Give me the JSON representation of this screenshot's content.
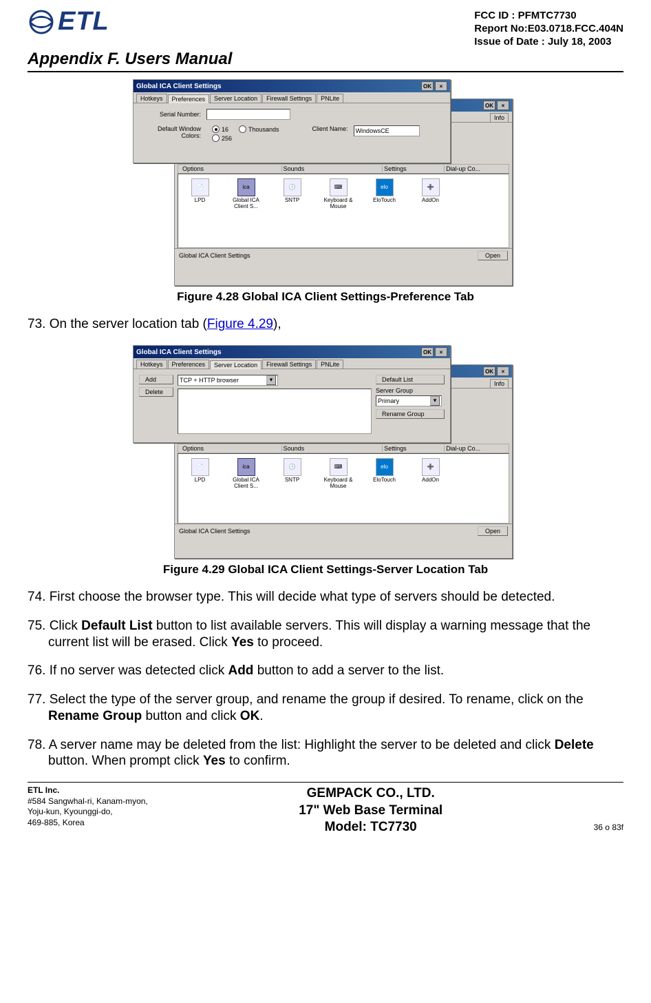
{
  "header": {
    "logo_text": "ETL",
    "fcc_id": "FCC ID : PFMTC7730",
    "report_no": "Report No:E03.0718.FCC.404N",
    "issue_date": "Issue of Date : July 18, 2003",
    "appendix": "Appendix F.  Users Manual"
  },
  "screenshot1": {
    "back_window_title_ok": "OK",
    "back_window_tab_info": "Info",
    "dialog_title": "Global ICA Client Settings",
    "ok_btn": "OK",
    "close_btn": "×",
    "tabs": {
      "hotkeys": "Hotkeys",
      "preferences": "Preferences",
      "server_location": "Server Location",
      "firewall": "Firewall Settings",
      "pnlite": "PNLite"
    },
    "labels": {
      "serial_number": "Serial Number:",
      "default_colors": "Default Window Colors:",
      "client_name": "Client Name:"
    },
    "radios": {
      "r16": "16",
      "r256": "256",
      "rthousands": "Thousands"
    },
    "client_name_value": "WindowsCE",
    "columns": {
      "options": "Options",
      "sounds": "Sounds",
      "settings": "Settings",
      "dialup": "Dial-up Co..."
    },
    "icons": {
      "lpd": "LPD",
      "global_ica": "Global ICA Client S...",
      "sntp": "SNTP",
      "kbm": "Keyboard & Mouse",
      "elo": "EloTouch",
      "addon": "AddOn"
    },
    "status_text": "Global ICA Client Settings",
    "open_btn": "Open"
  },
  "caption1": "Figure 4.28      Global ICA Client Settings-Preference Tab",
  "step73": {
    "num": "73.",
    "pre": "On the server location tab (",
    "link": "Figure 4.29",
    "post": "),"
  },
  "screenshot2": {
    "dialog_title": "Global ICA Client Settings",
    "ok_btn": "OK",
    "close_btn": "×",
    "tabs": {
      "hotkeys": "Hotkeys",
      "preferences": "Preferences",
      "server_location": "Server Location",
      "firewall": "Firewall Settings",
      "pnlite": "PNLite"
    },
    "add_btn": "Add",
    "delete_btn": "Delete",
    "browser_type": "TCP + HTTP browser",
    "default_list_btn": "Default List",
    "server_group_label": "Server Group",
    "server_group_value": "Primary",
    "rename_group_btn": "Rename Group",
    "columns": {
      "options": "Options",
      "sounds": "Sounds",
      "settings": "Settings",
      "dialup": "Dial-up Co..."
    },
    "icons": {
      "lpd": "LPD",
      "global_ica": "Global ICA Client S...",
      "sntp": "SNTP",
      "kbm": "Keyboard & Mouse",
      "elo": "EloTouch",
      "addon": "AddOn"
    },
    "status_text": "Global ICA Client Settings",
    "open_btn": "Open"
  },
  "caption2": "Figure 4.29      Global ICA Client Settings-Server Location Tab",
  "step74": {
    "num": "74.",
    "text": "First choose the browser type.  This will decide what type of servers should be detected."
  },
  "step75": {
    "num": "75.",
    "t1": "Click ",
    "b1": "Default List",
    "t2": " button to list available servers.  This will display a warning message that the current list will be erased.  Click ",
    "b2": "Yes",
    "t3": " to proceed."
  },
  "step76": {
    "num": "76.",
    "t1": "If no server was detected click ",
    "b1": "Add",
    "t2": " button to add a server to the list."
  },
  "step77": {
    "num": "77.",
    "t1": "Select the type of the server group, and rename the group if desired.  To rename, click on the ",
    "b1": "Rename Group",
    "t2": " button and click ",
    "b2": "OK",
    "t3": "."
  },
  "step78": {
    "num": "78.",
    "t1": "A server name may be deleted from the list:  Highlight the server to be deleted and click ",
    "b1": "Delete",
    "t2": " button.  When prompt click ",
    "b2": "Yes",
    "t3": " to confirm."
  },
  "footer": {
    "etl": "ETL Inc.",
    "addr1": "#584 Sangwhal-ri, Kanam-myon,",
    "addr2": "Yoju-kun, Kyounggi-do,",
    "addr3": "469-885, Korea",
    "center1": "GEMPACK CO., LTD.",
    "center2": "17\" Web Base Terminal",
    "center3": "Model: TC7730",
    "page": "36 o 83f"
  }
}
